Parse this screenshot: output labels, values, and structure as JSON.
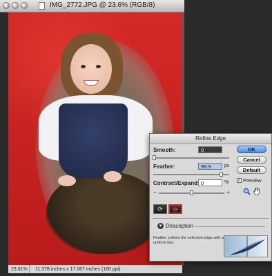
{
  "document": {
    "title": "IMG_2772.JPG @ 23.6% (RGB/8)",
    "zoom_status": "23.61%",
    "doc_info": "11.378 inches x 17.067 inches (180 ppi)"
  },
  "dialog": {
    "title": "Refine Edge",
    "smooth": {
      "label": "Smooth:",
      "value": "0"
    },
    "feather": {
      "label": "Feather:",
      "value": "99.9",
      "unit": "px"
    },
    "contract": {
      "label": "Contract/Expand:",
      "value": "0",
      "unit": "%",
      "minus": "−",
      "plus": "+"
    },
    "buttons": {
      "ok": "OK",
      "cancel": "Cancel",
      "default": "Default"
    },
    "preview": {
      "label": "Preview",
      "checked_glyph": "✓"
    },
    "description": {
      "title": "Description",
      "text_line1": "Feather softens the selection edge with a",
      "text_line2": "uniform blur."
    },
    "icons": {
      "zoom": "zoom-tool-icon",
      "hand": "hand-tool-icon",
      "mode1": "mode-standard-icon",
      "mode2": "mode-quickmask-icon"
    }
  },
  "colors": {
    "background_red": "#c9201f",
    "ok_button": "#4b8ae0"
  }
}
